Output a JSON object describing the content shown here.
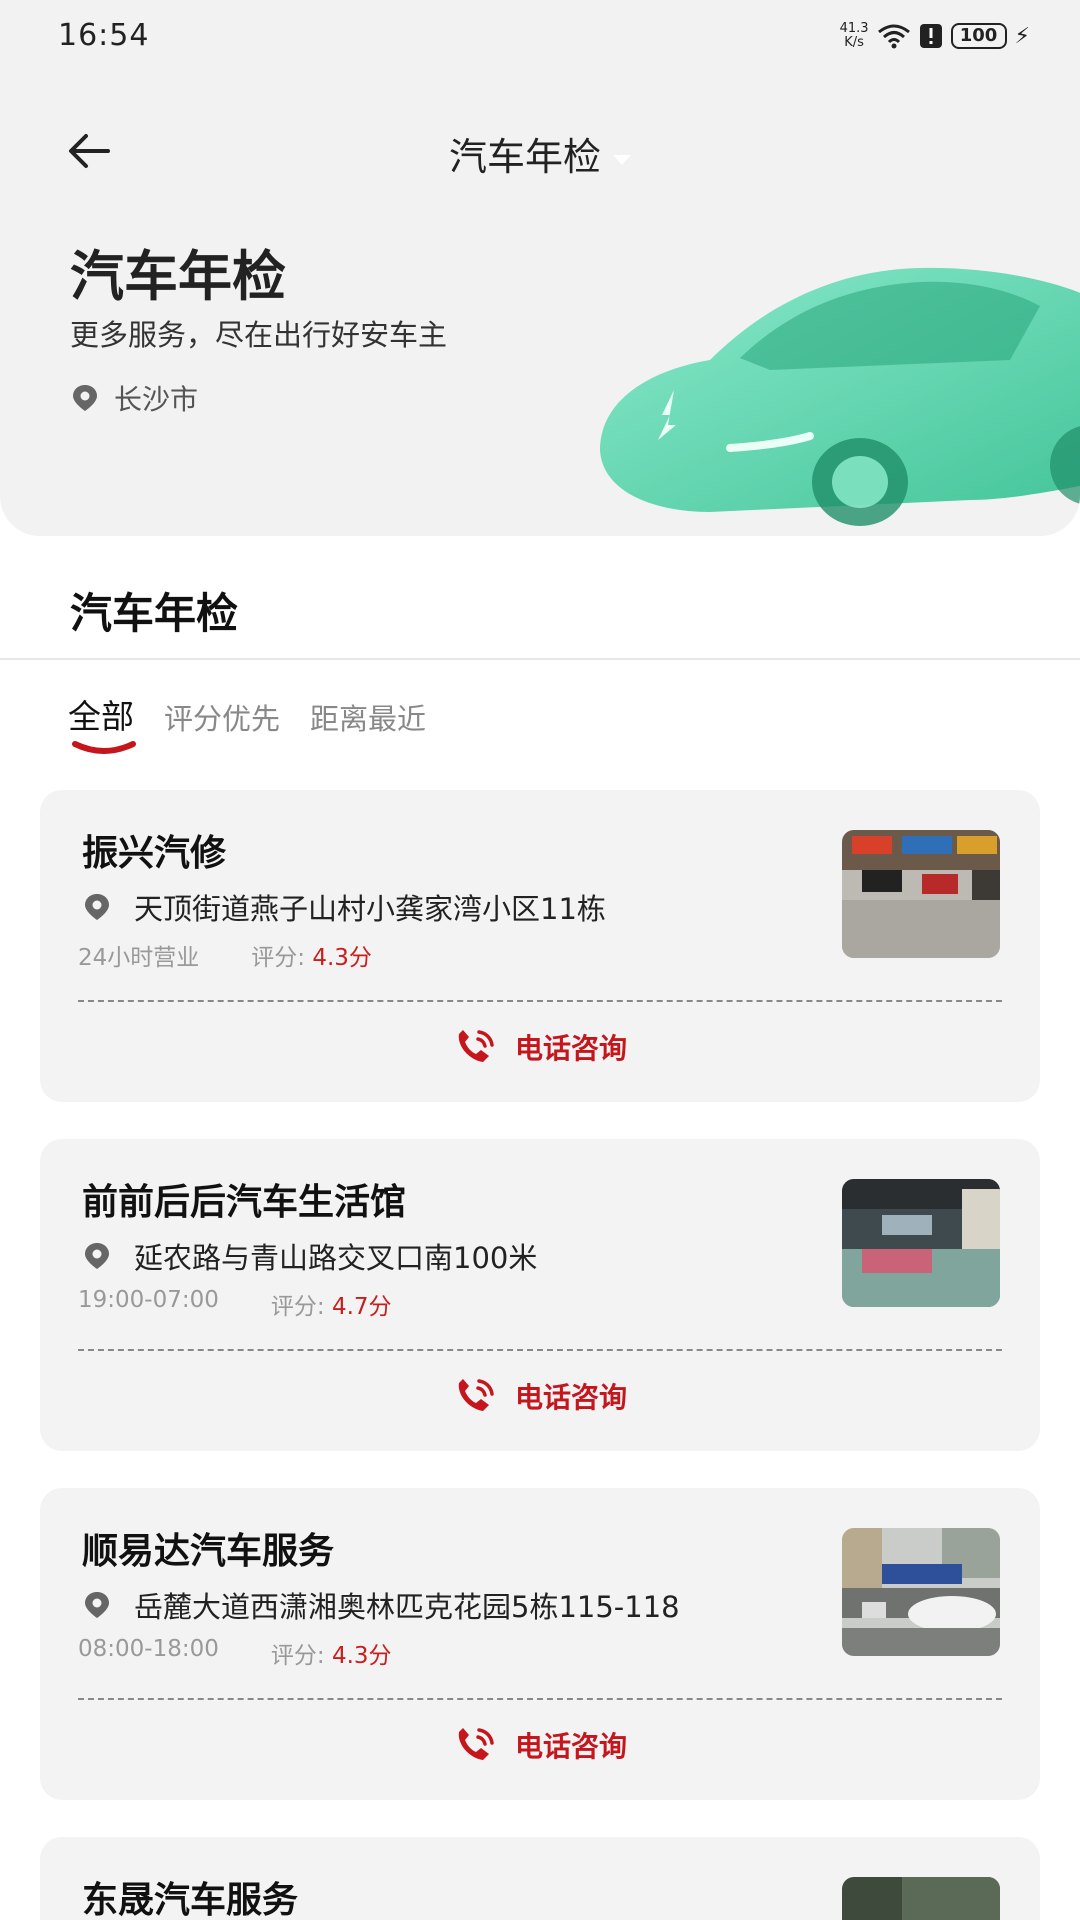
{
  "status": {
    "time": "16:54",
    "net_speed_top": "41.3",
    "net_speed_unit": "K/s",
    "battery": "100"
  },
  "header": {
    "title": "汽车年检"
  },
  "hero": {
    "title": "汽车年检",
    "subtitle": "更多服务，尽在出行好安车主",
    "location": "长沙市"
  },
  "section": {
    "title": "汽车年检"
  },
  "tabs": [
    {
      "label": "全部",
      "active": true
    },
    {
      "label": "评分优先",
      "active": false
    },
    {
      "label": "距离最近",
      "active": false
    }
  ],
  "shops": [
    {
      "name": "振兴汽修",
      "address": "天顶街道燕子山村小龚家湾小区11栋",
      "hours": "24小时营业",
      "rating_label": "评分:",
      "rating": "4.3分",
      "call_label": "电话咨询"
    },
    {
      "name": "前前后后汽车生活馆",
      "address": "延农路与青山路交叉口南100米",
      "hours": "19:00-07:00",
      "rating_label": "评分:",
      "rating": "4.7分",
      "call_label": "电话咨询"
    },
    {
      "name": "顺易达汽车服务",
      "address": "岳麓大道西潇湘奥林匹克花园5栋115-118",
      "hours": "08:00-18:00",
      "rating_label": "评分:",
      "rating": "4.3分",
      "call_label": "电话咨询"
    },
    {
      "name": "东晟汽车服务",
      "address": "",
      "hours": "",
      "rating_label": "",
      "rating": "",
      "call_label": ""
    }
  ],
  "colors": {
    "accent": "#c4161c",
    "card_bg": "#f3f3f3",
    "hero_bg": "#f2f2f2"
  }
}
